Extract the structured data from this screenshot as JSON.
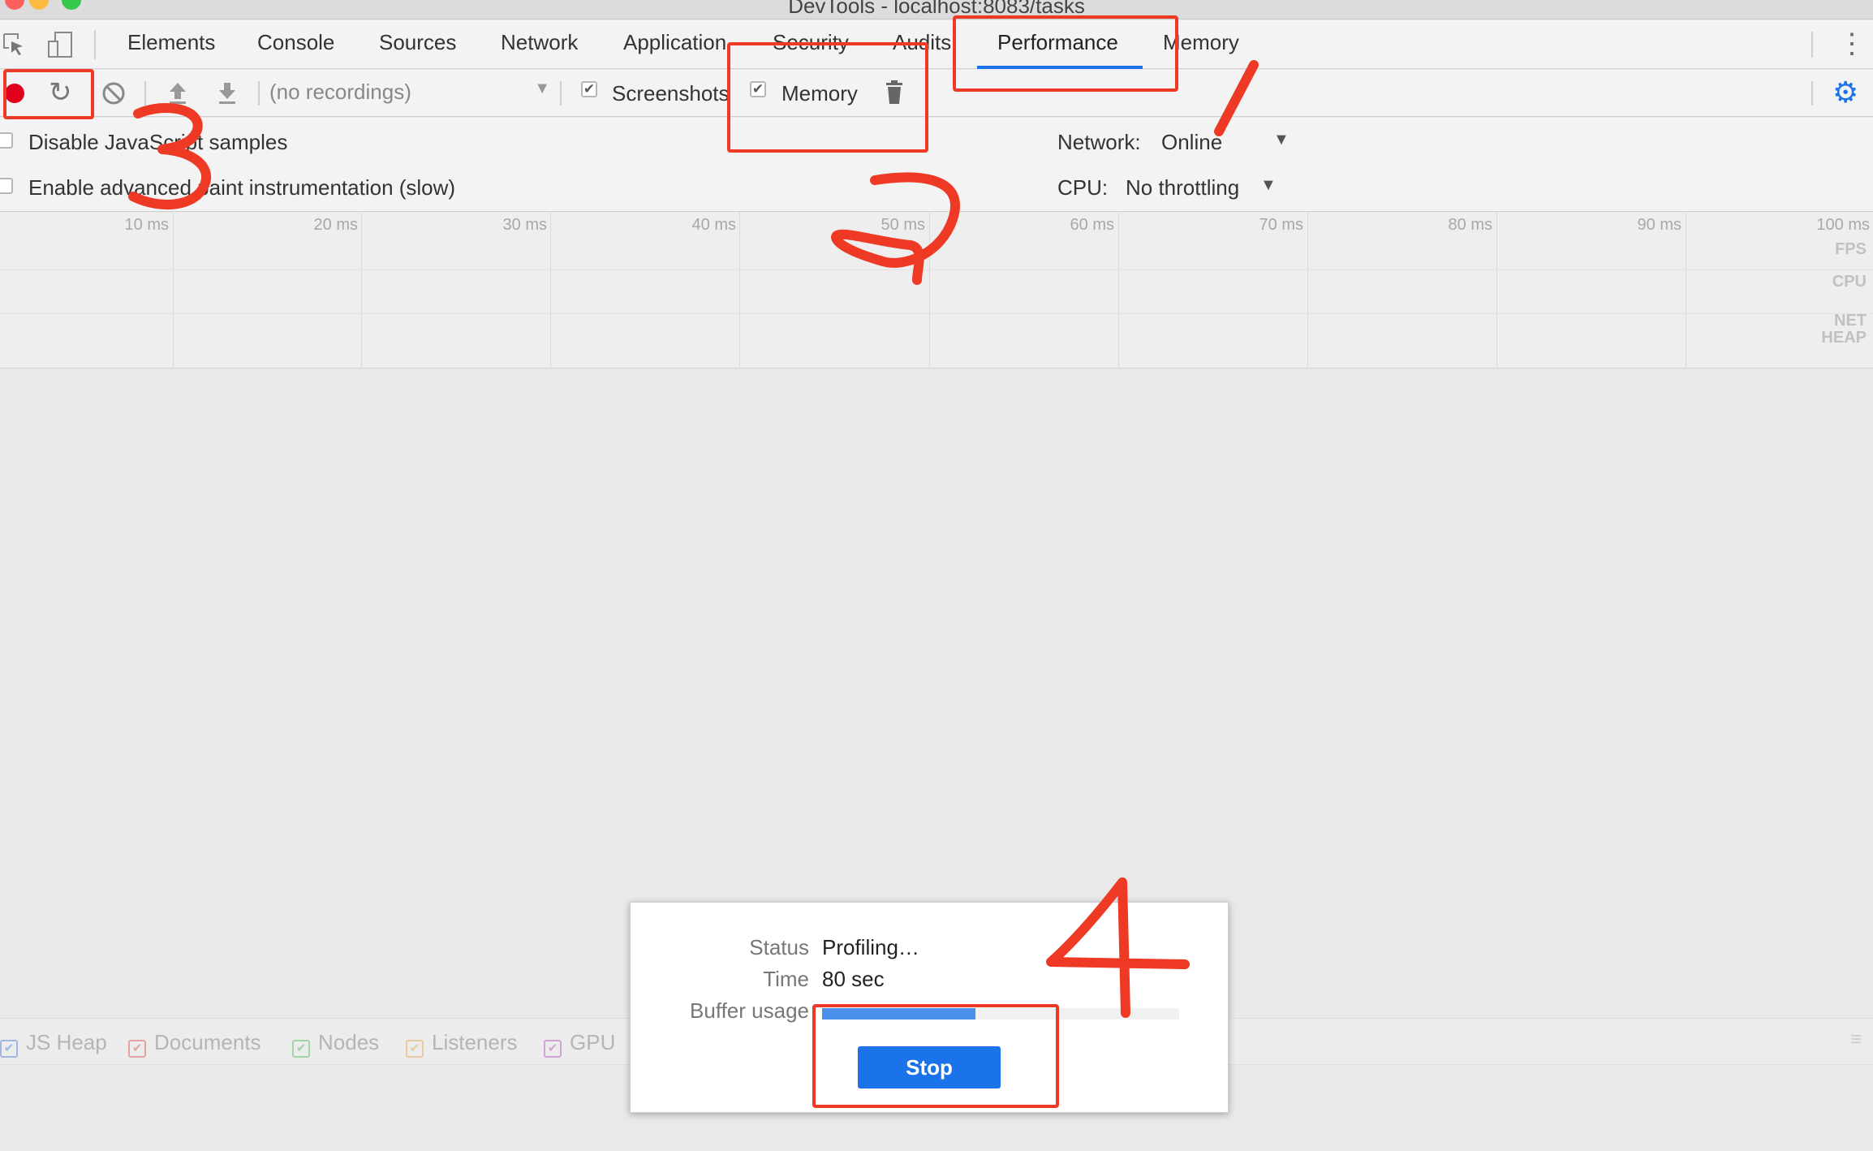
{
  "window": {
    "title": "DevTools - localhost:8083/tasks"
  },
  "tabs": [
    {
      "label": "Elements"
    },
    {
      "label": "Console"
    },
    {
      "label": "Sources"
    },
    {
      "label": "Network"
    },
    {
      "label": "Application"
    },
    {
      "label": "Security"
    },
    {
      "label": "Audits"
    },
    {
      "label": "Performance",
      "active": true
    },
    {
      "label": "Memory"
    }
  ],
  "toolbar": {
    "recordings_placeholder": "(no recordings)",
    "screenshots_label": "Screenshots",
    "screenshots_checked": true,
    "memory_label": "Memory",
    "memory_checked": true
  },
  "settings": {
    "disable_js_samples": "Disable JavaScript samples",
    "enable_paint": "Enable advanced paint instrumentation (slow)",
    "network_label": "Network:",
    "network_value": "Online",
    "cpu_label": "CPU:",
    "cpu_value": "No throttling"
  },
  "overview": {
    "ticks": [
      "10 ms",
      "20 ms",
      "30 ms",
      "40 ms",
      "50 ms",
      "60 ms",
      "70 ms",
      "80 ms",
      "90 ms",
      "100 ms"
    ],
    "rows": {
      "fps": "FPS",
      "cpu": "CPU",
      "net": "NET",
      "heap": "HEAP"
    }
  },
  "counters": [
    {
      "label": "JS Heap",
      "color": "#9fb8e3"
    },
    {
      "label": "Documents",
      "color": "#e3a3a3"
    },
    {
      "label": "Nodes",
      "color": "#a3d4a3"
    },
    {
      "label": "Listeners",
      "color": "#e8c9a0"
    },
    {
      "label": "GPU",
      "color": "#d4a3d4"
    }
  ],
  "dialog": {
    "status_label": "Status",
    "status_value": "Profiling…",
    "time_label": "Time",
    "time_value": "80 sec",
    "buffer_label": "Buffer usage",
    "buffer_fraction": 0.43,
    "stop_label": "Stop"
  },
  "annotations": {
    "step1": "1",
    "step2": "2",
    "step3": "3",
    "step4": "4"
  },
  "colors": {
    "accent": "#1a73e8",
    "record": "#e0001b",
    "annotation": "#ee3a24"
  }
}
